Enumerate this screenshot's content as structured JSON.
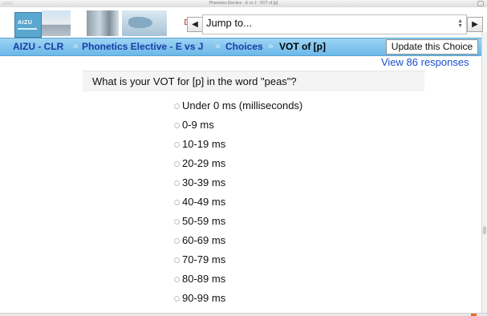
{
  "window": {
    "title": "Phonetics Elective - E vs J : VOT of [p]"
  },
  "header": {
    "logo_text": "AIZU",
    "jump_label": "Jump to...",
    "prev_symbol": "◀",
    "next_symbol": "▶"
  },
  "breadcrumb": {
    "items": [
      {
        "label": "AIZU - CLR"
      },
      {
        "label": "Phonetics Elective - E vs J"
      },
      {
        "label": "Choices"
      },
      {
        "label": "VOT of [p]"
      }
    ],
    "separator": "»"
  },
  "actions": {
    "update_label": "Update this Choice",
    "view_responses_label": "View 86 responses"
  },
  "question": {
    "text": "What is your VOT for [p] in the word \"peas\"?"
  },
  "options": [
    "Under 0 ms (milliseconds)",
    "0-9 ms",
    "10-19 ms",
    "20-29 ms",
    "30-39 ms",
    "40-49 ms",
    "50-59 ms",
    "60-69 ms",
    "70-79 ms",
    "80-89 ms",
    "90-99 ms"
  ],
  "colors": {
    "nav_bar": "#7cc2ed",
    "link": "#1a4fd0",
    "breadcrumb_link": "#1a3ca8"
  }
}
